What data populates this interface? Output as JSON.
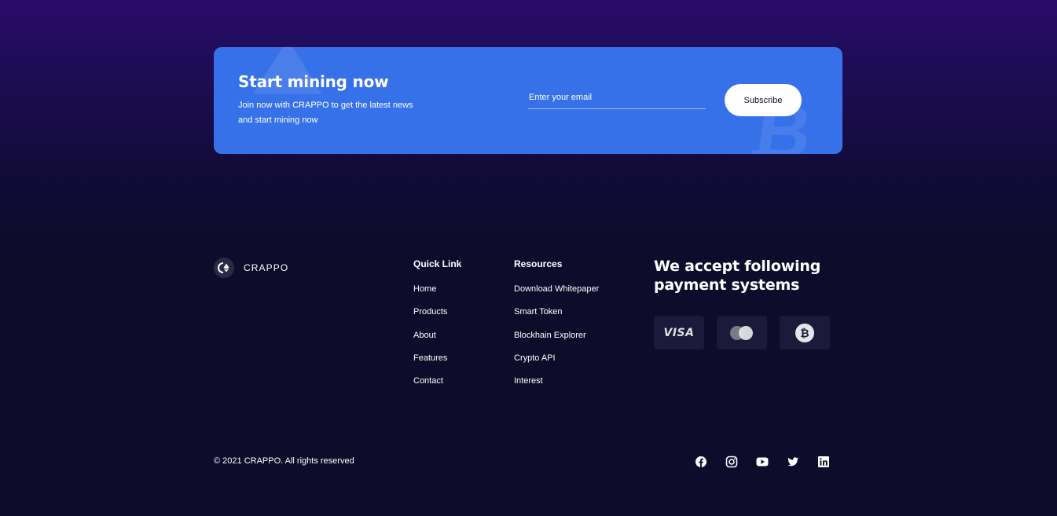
{
  "newsletter": {
    "title": "Start mining now",
    "text": "Join now with CRAPPO to get the latest news and start mining now",
    "email_placeholder": "Enter your email",
    "subscribe_label": "Subscribe"
  },
  "brand": {
    "name": "CRAPPO"
  },
  "quick_links": {
    "heading": "Quick Link",
    "items": [
      "Home",
      "Products",
      "About",
      "Features",
      "Contact"
    ]
  },
  "resources": {
    "heading": "Resources",
    "items": [
      "Download Whitepaper",
      "Smart Token",
      "Blockhain Explorer",
      "Crypto API",
      "Interest"
    ]
  },
  "payments": {
    "title": "We accept following payment systems",
    "methods": [
      {
        "icon": "visa-icon",
        "label": "VISA"
      },
      {
        "icon": "mastercard-icon",
        "label": ""
      },
      {
        "icon": "bitcoin-icon",
        "label": ""
      }
    ]
  },
  "footer": {
    "copyright": "© 2021 CRAPPO. All rights reserved",
    "socials": [
      "facebook-icon",
      "instagram-icon",
      "youtube-icon",
      "twitter-icon",
      "linkedin-icon"
    ]
  },
  "colors": {
    "banner": "#3671e9",
    "background": "#0d0c2b",
    "card": "#1b1a3b",
    "accent_top": "#2a0a6b"
  }
}
